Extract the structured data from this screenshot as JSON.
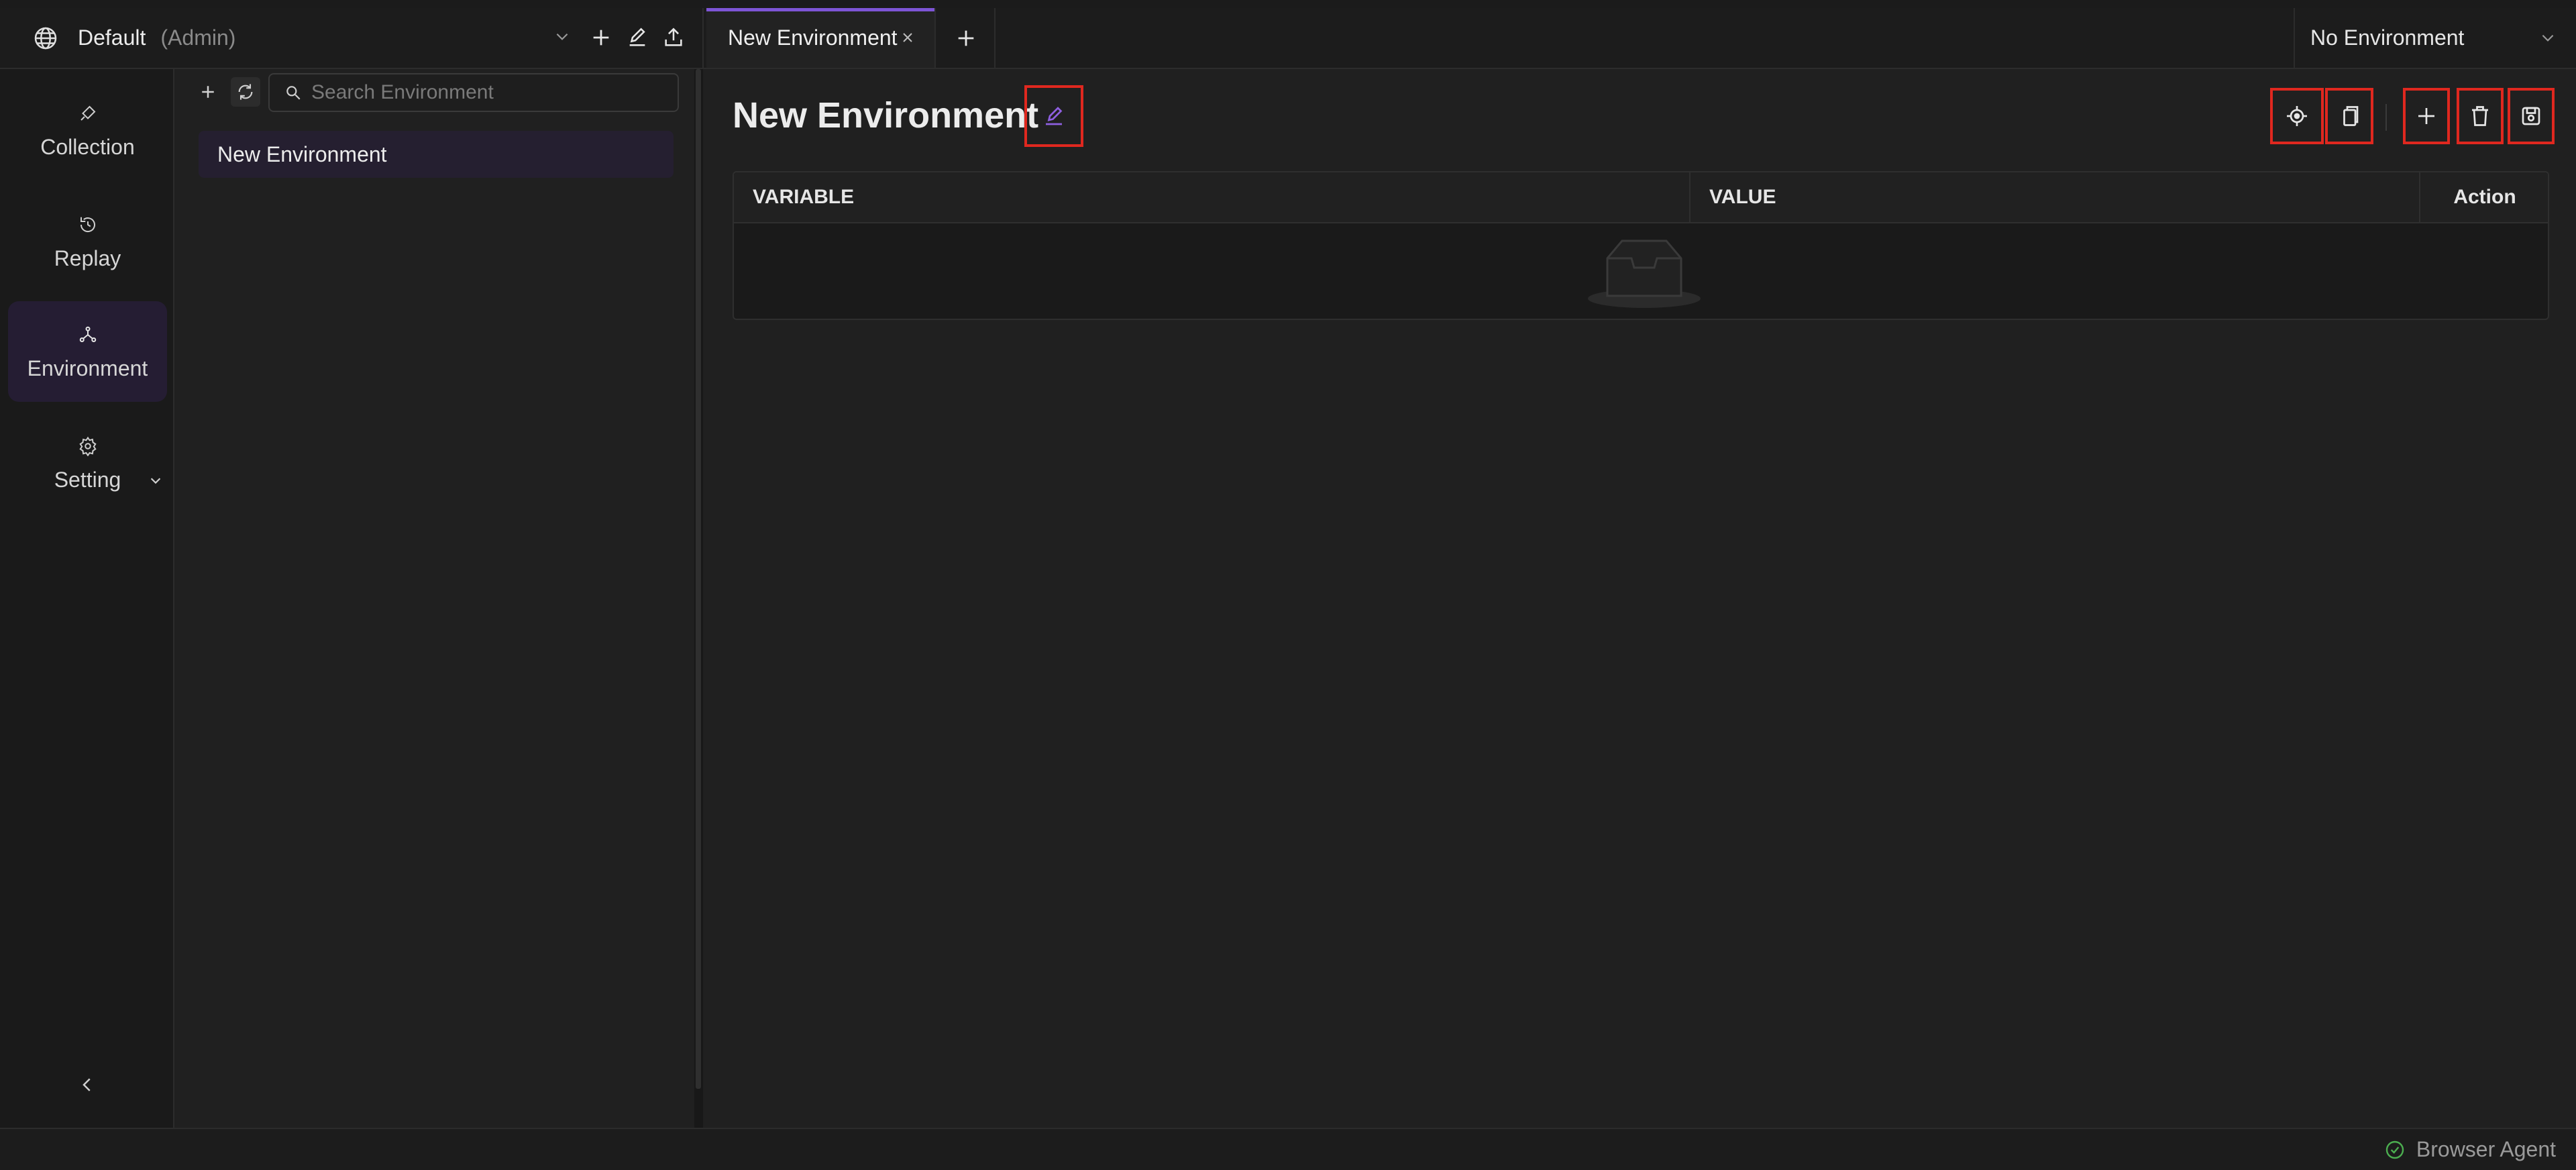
{
  "workspace": {
    "name": "Default",
    "role": "(Admin)"
  },
  "tabs": [
    {
      "label": "New Environment"
    }
  ],
  "env_selector": {
    "label": "No Environment"
  },
  "nav": {
    "items": [
      {
        "label": "Collection",
        "icon": "collection-icon"
      },
      {
        "label": "Replay",
        "icon": "replay-icon"
      },
      {
        "label": "Environment",
        "icon": "environment-icon",
        "active": true
      },
      {
        "label": "Setting",
        "icon": "gear-icon"
      }
    ]
  },
  "panel": {
    "search_placeholder": "Search Environment",
    "environments": [
      {
        "label": "New Environment",
        "selected": true
      }
    ]
  },
  "main": {
    "title": "New Environment",
    "columns": [
      "VARIABLE",
      "VALUE",
      "Action"
    ],
    "rows": []
  },
  "status": {
    "agent_label": "Browser Agent"
  },
  "colors": {
    "accent": "#7e55d6",
    "highlight_box": "#e0281f",
    "success": "#4caf50"
  }
}
